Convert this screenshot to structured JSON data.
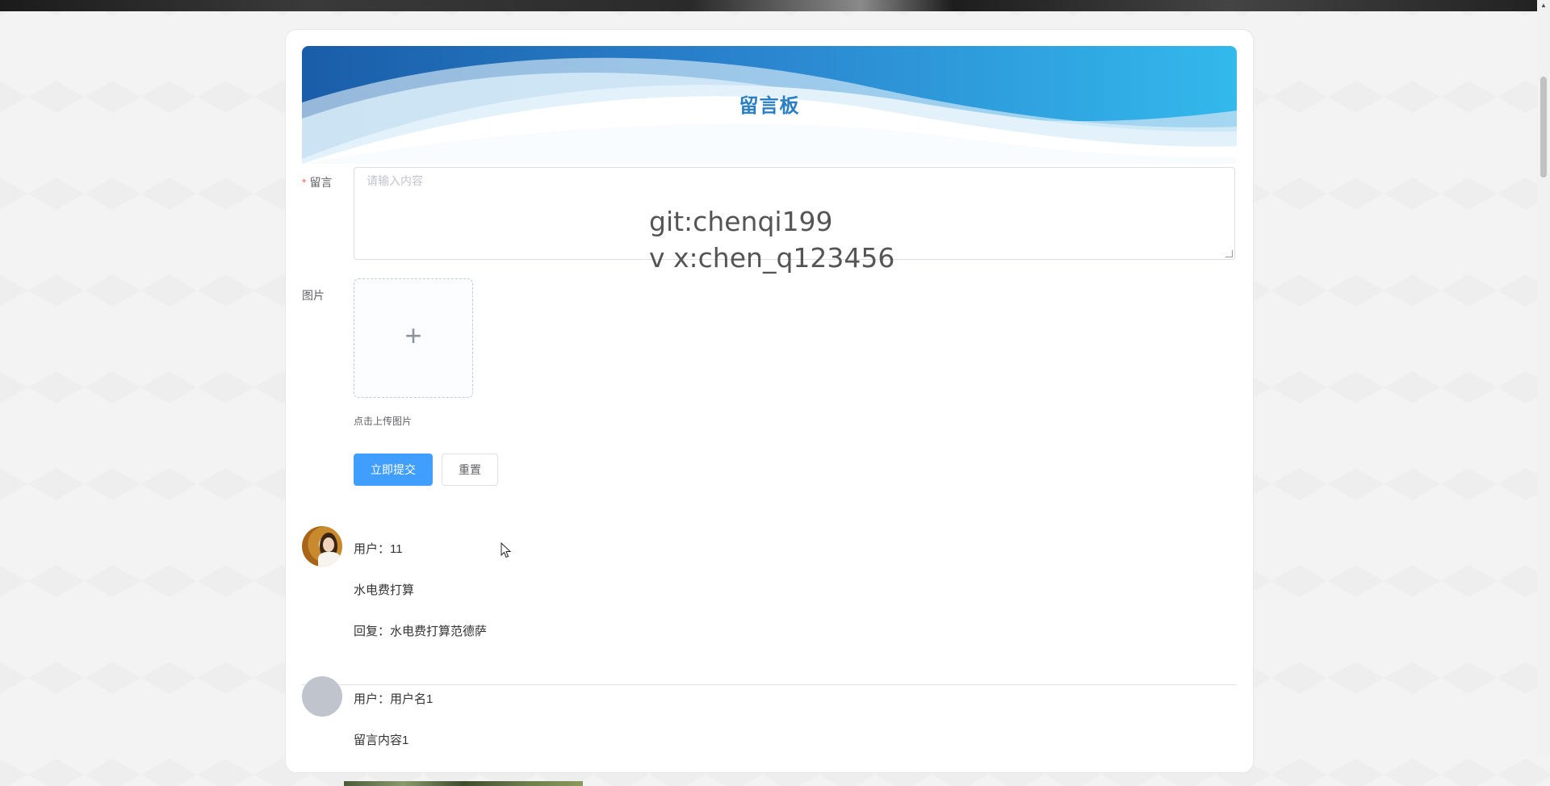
{
  "header": {
    "title": "留言板"
  },
  "form": {
    "message_label": "留言",
    "message_placeholder": "请输入内容",
    "image_label": "图片",
    "upload_tip": "点击上传图片",
    "submit_label": "立即提交",
    "reset_label": "重置"
  },
  "watermark": {
    "line1": "git:chenqi199",
    "line2": "v x:chen_q123456"
  },
  "messages": [
    {
      "user": "用户：11",
      "content": "水电费打算",
      "reply": "回复：水电费打算范德萨"
    },
    {
      "user": "用户：用户名1",
      "content": "留言内容1"
    }
  ],
  "colors": {
    "primary": "#409eff",
    "title": "#2a7fc4",
    "required": "#f56c6c"
  }
}
